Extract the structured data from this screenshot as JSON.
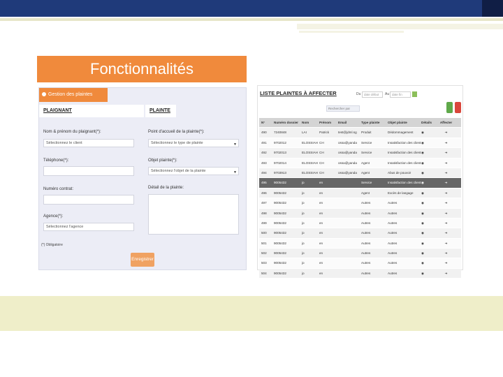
{
  "slide": {
    "title": "Fonctionnalités",
    "colors": {
      "accent": "#f08a3c",
      "top_bar": "#1f3a7a",
      "band": "#efeec9"
    }
  },
  "form": {
    "header": "Gestion des plaintes",
    "header_icon": "plus-circle-icon",
    "tabs": [
      "PLAIGNANT",
      "PLAINTE"
    ],
    "plaignant": {
      "fields": [
        {
          "label": "Nom & prénom du plaignant(*):",
          "value": "Sélectionnez le client"
        },
        {
          "label": "Téléphone(*):",
          "value": ""
        },
        {
          "label": "Numéro contrat:",
          "value": ""
        },
        {
          "label": "Agence(*):",
          "value": "Sélectionnez l'agence"
        }
      ]
    },
    "plainte": {
      "fields": [
        {
          "label": "Point d'accueil de la plainte(*):",
          "value": "Sélectionnez le type de plainte"
        },
        {
          "label": "Objet plainte(*):",
          "value": "Sélectionnez l'objet de la plainte"
        },
        {
          "label": "Détail de la plainte:",
          "value": ""
        }
      ]
    },
    "required_note": "(*) Obligatoire",
    "save_label": "Enregistrer"
  },
  "list": {
    "title": "LISTE PLAINTES À AFFECTER",
    "filter_from_label": "Du",
    "filter_from_placeholder": "date début",
    "filter_to_label": "Au",
    "filter_to_placeholder": "date fin",
    "search_placeholder": "Rechercher par",
    "columns": [
      "N°",
      "Numéro dossier",
      "Nom",
      "Prénom",
      "Email",
      "Type plainte",
      "Objet plainte",
      "Détails",
      "Affecter"
    ],
    "rows": [
      [
        "490",
        "7240848",
        "LAI",
        "Patrick",
        "test@jdml.sg",
        "Produit",
        "Dédommagement",
        "◉",
        "➔"
      ],
      [
        "491",
        "9702012",
        "ELOSSIAH",
        "CH",
        "ossa@yanda",
        "Service",
        "Insatisfaction des clients",
        "◉",
        "➔"
      ],
      [
        "492",
        "9702013",
        "ELOSSIAH",
        "CH",
        "ossa@yanda",
        "Service",
        "Insatisfaction des clients",
        "◉",
        "➔"
      ],
      [
        "493",
        "9702014",
        "ELOSSIAH",
        "CH",
        "ossa@yanda",
        "Agent",
        "Insatisfaction des clients",
        "◉",
        "➔"
      ],
      [
        "494",
        "9703913",
        "ELOSSIAH",
        "CH",
        "ossa@yanda",
        "Agent",
        "Abus de pouvoir",
        "◉",
        "➔"
      ],
      [
        "495",
        "9005432",
        "jo",
        "en",
        "",
        "Service",
        "Insatisfaction des clients",
        "◉",
        "➔"
      ],
      [
        "496",
        "9005432",
        "jo",
        "en",
        "",
        "Agent",
        "Excès de langage",
        "◉",
        "➔"
      ],
      [
        "497",
        "9005432",
        "jo",
        "en",
        "",
        "Autres",
        "Autres",
        "◉",
        "➔"
      ],
      [
        "498",
        "9005432",
        "jo",
        "en",
        "",
        "Autres",
        "Autres",
        "◉",
        "➔"
      ],
      [
        "499",
        "9005432",
        "jo",
        "en",
        "",
        "Autres",
        "Autres",
        "◉",
        "➔"
      ],
      [
        "500",
        "9005432",
        "jo",
        "en",
        "",
        "Autres",
        "Autres",
        "◉",
        "➔"
      ],
      [
        "501",
        "9005432",
        "jo",
        "en",
        "",
        "Autres",
        "Autres",
        "◉",
        "➔"
      ],
      [
        "502",
        "9005432",
        "jo",
        "en",
        "",
        "Autres",
        "Autres",
        "◉",
        "➔"
      ],
      [
        "503",
        "9005432",
        "jo",
        "en",
        "",
        "Autres",
        "Autres",
        "◉",
        "➔"
      ],
      [
        "504",
        "9005432",
        "jo",
        "en",
        "",
        "Autres",
        "Autres",
        "◉",
        "➔"
      ]
    ],
    "selected_row": 5
  }
}
